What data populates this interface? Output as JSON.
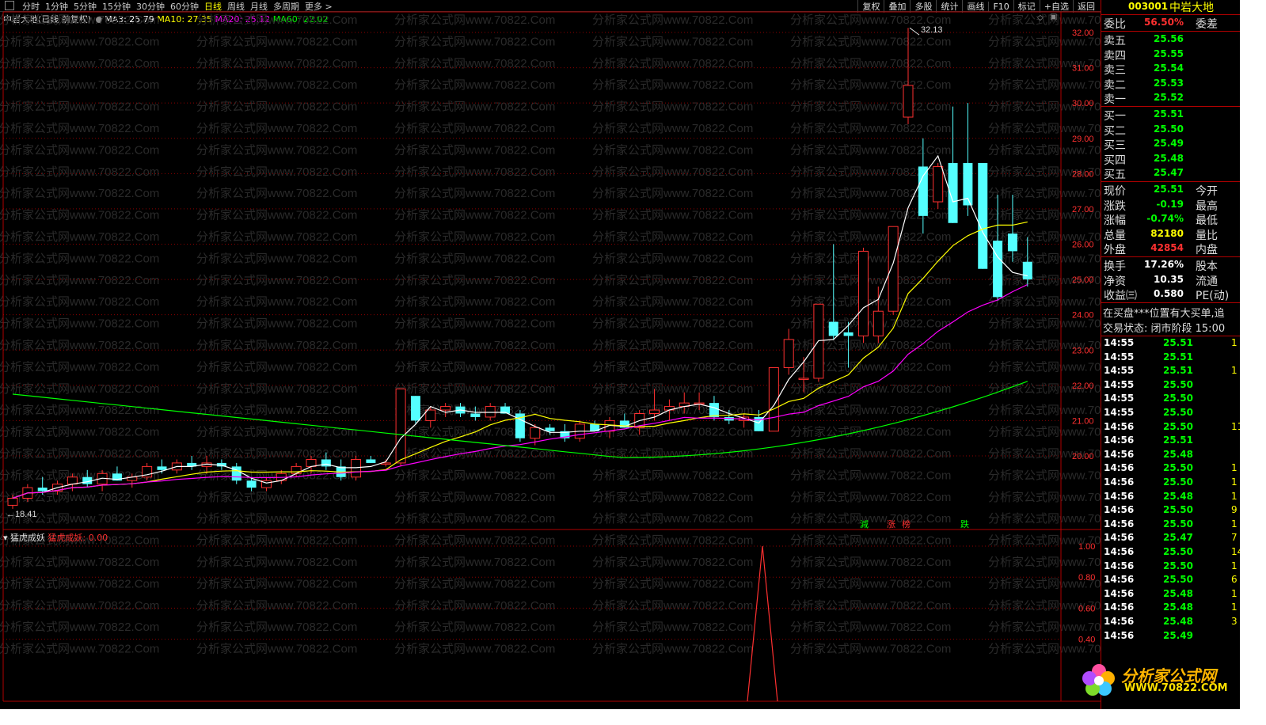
{
  "toolbar": {
    "periods": [
      "分时",
      "1分钟",
      "5分钟",
      "15分钟",
      "30分钟",
      "60分钟",
      "日线",
      "周线",
      "月线",
      "多周期",
      "更多 >"
    ],
    "active_period": "日线",
    "actions": [
      "复权",
      "叠加",
      "多股",
      "统计",
      "画线",
      "F10",
      "标记",
      "+自选",
      "返回"
    ]
  },
  "chart_title": {
    "name": "中岩大地(日线 前复权)",
    "ma3": "MA3: 25.79",
    "ma10": "MA10: 27.35",
    "ma20": "MA20: 25.12",
    "ma60": "MA60: 22.02"
  },
  "indicator_title": {
    "name": "猛虎成妖",
    "value": "猛虎成妖: 0.00"
  },
  "chart_data": {
    "type": "candlestick",
    "price_axis": {
      "ticks": [
        "32.00",
        "31.00",
        "30.00",
        "29.00",
        "28.00",
        "27.00",
        "26.00",
        "25.00",
        "24.00",
        "23.00",
        "22.00",
        "21.00",
        "20.00"
      ]
    },
    "indicator_axis": {
      "ticks": [
        "1.00",
        "0.80",
        "0.60",
        "0.40"
      ]
    },
    "annotations": {
      "high_label": "32.13",
      "low_label": "18.41",
      "signals": [
        "減",
        "涨",
        "榜",
        "跌"
      ]
    },
    "ohlc": [
      [
        18.6,
        18.9,
        18.5,
        18.8
      ],
      [
        18.8,
        19.2,
        18.7,
        19.1
      ],
      [
        19.1,
        19.4,
        18.9,
        19.0
      ],
      [
        19.0,
        19.3,
        18.9,
        19.2
      ],
      [
        19.2,
        19.5,
        19.0,
        19.4
      ],
      [
        19.4,
        19.6,
        19.1,
        19.2
      ],
      [
        19.2,
        19.6,
        19.0,
        19.5
      ],
      [
        19.5,
        19.7,
        19.3,
        19.3
      ],
      [
        19.3,
        19.5,
        19.1,
        19.4
      ],
      [
        19.4,
        19.8,
        19.3,
        19.7
      ],
      [
        19.7,
        19.9,
        19.5,
        19.6
      ],
      [
        19.6,
        19.9,
        19.5,
        19.8
      ],
      [
        19.8,
        20.0,
        19.6,
        19.7
      ],
      [
        19.7,
        20.0,
        19.5,
        19.8
      ],
      [
        19.8,
        19.9,
        19.6,
        19.7
      ],
      [
        19.7,
        19.8,
        19.2,
        19.3
      ],
      [
        19.3,
        19.4,
        19.0,
        19.1
      ],
      [
        19.1,
        19.4,
        19.0,
        19.3
      ],
      [
        19.3,
        19.6,
        19.2,
        19.5
      ],
      [
        19.5,
        19.8,
        19.4,
        19.7
      ],
      [
        19.7,
        20.0,
        19.5,
        19.9
      ],
      [
        19.9,
        20.1,
        19.6,
        19.7
      ],
      [
        19.7,
        19.9,
        19.3,
        19.4
      ],
      [
        19.4,
        20.0,
        19.3,
        19.9
      ],
      [
        19.9,
        20.0,
        19.8,
        19.8
      ],
      [
        19.8,
        19.9,
        19.7,
        19.8
      ],
      [
        19.8,
        21.9,
        19.7,
        21.9
      ],
      [
        21.7,
        21.7,
        20.9,
        21.0
      ],
      [
        21.0,
        21.4,
        20.8,
        21.3
      ],
      [
        21.3,
        21.5,
        21.1,
        21.4
      ],
      [
        21.4,
        21.5,
        21.1,
        21.2
      ],
      [
        21.2,
        21.4,
        21.0,
        21.1
      ],
      [
        21.1,
        21.5,
        21.0,
        21.4
      ],
      [
        21.4,
        21.5,
        21.2,
        21.2
      ],
      [
        21.2,
        21.3,
        20.4,
        20.5
      ],
      [
        20.5,
        20.9,
        20.3,
        20.8
      ],
      [
        20.8,
        20.9,
        20.6,
        20.7
      ],
      [
        20.7,
        20.9,
        20.4,
        20.5
      ],
      [
        20.5,
        21.0,
        20.4,
        20.9
      ],
      [
        20.9,
        21.0,
        20.7,
        20.7
      ],
      [
        20.7,
        21.1,
        20.5,
        21.0
      ],
      [
        21.0,
        21.2,
        20.8,
        20.8
      ],
      [
        20.8,
        21.3,
        20.6,
        21.2
      ],
      [
        21.2,
        21.9,
        21.0,
        21.3
      ],
      [
        21.3,
        21.6,
        21.0,
        21.4
      ],
      [
        21.4,
        21.8,
        21.2,
        21.5
      ],
      [
        21.5,
        21.8,
        21.3,
        21.5
      ],
      [
        21.5,
        21.7,
        21.0,
        21.1
      ],
      [
        21.1,
        21.3,
        20.9,
        21.0
      ],
      [
        21.0,
        21.2,
        20.8,
        21.1
      ],
      [
        21.1,
        21.3,
        20.7,
        20.7
      ],
      [
        20.7,
        22.5,
        20.7,
        22.5
      ],
      [
        22.5,
        23.6,
        22.3,
        23.3
      ],
      [
        22.2,
        22.8,
        21.8,
        22.2
      ],
      [
        22.2,
        24.3,
        22.1,
        24.3
      ],
      [
        23.8,
        26.0,
        23.3,
        23.4
      ],
      [
        23.5,
        23.8,
        22.5,
        23.4
      ],
      [
        23.4,
        25.9,
        23.2,
        25.8
      ],
      [
        23.4,
        24.8,
        23.2,
        24.1
      ],
      [
        24.1,
        26.5,
        24.0,
        26.5
      ],
      [
        29.6,
        32.13,
        29.4,
        30.5
      ],
      [
        28.2,
        29.0,
        26.3,
        26.8
      ],
      [
        27.2,
        28.3,
        27.0,
        28.2
      ],
      [
        28.3,
        29.9,
        26.6,
        26.6
      ],
      [
        28.3,
        30.0,
        26.8,
        27.1
      ],
      [
        28.3,
        28.3,
        25.3,
        25.3
      ],
      [
        26.1,
        27.4,
        24.4,
        24.5
      ],
      [
        26.3,
        27.4,
        25.5,
        25.8
      ],
      [
        25.5,
        26.2,
        24.8,
        25.0
      ]
    ]
  },
  "panel": {
    "code": "003001",
    "name": "中岩大地",
    "weibi": {
      "label": "委比",
      "value": "56.50%",
      "label2": "委差"
    },
    "asks": [
      {
        "label": "卖五",
        "price": "25.56"
      },
      {
        "label": "卖四",
        "price": "25.55"
      },
      {
        "label": "卖三",
        "price": "25.54"
      },
      {
        "label": "卖二",
        "price": "25.53"
      },
      {
        "label": "卖一",
        "price": "25.52"
      }
    ],
    "bids": [
      {
        "label": "买一",
        "price": "25.51"
      },
      {
        "label": "买二",
        "price": "25.50"
      },
      {
        "label": "买三",
        "price": "25.49"
      },
      {
        "label": "买四",
        "price": "25.48"
      },
      {
        "label": "买五",
        "price": "25.47"
      }
    ],
    "stats": [
      {
        "label": "现价",
        "value": "25.51",
        "label2": "今开",
        "cls": "g"
      },
      {
        "label": "涨跌",
        "value": "-0.19",
        "label2": "最高",
        "cls": "g"
      },
      {
        "label": "涨幅",
        "value": "-0.74%",
        "label2": "最低",
        "cls": "g"
      },
      {
        "label": "总量",
        "value": "82180",
        "label2": "量比",
        "cls": "y"
      },
      {
        "label": "外盘",
        "value": "42854",
        "label2": "内盘",
        "cls": "r"
      }
    ],
    "stats2": [
      {
        "label": "换手",
        "value": "17.26%",
        "label2": "股本"
      },
      {
        "label": "净资",
        "value": "10.35",
        "label2": "流通"
      },
      {
        "label": "收益㈢",
        "value": "0.580",
        "label2": "PE(动)"
      }
    ],
    "notice": "在买盘***位置有大买单,追",
    "status": "交易状态: 闭市阶段 15:00",
    "ticks": [
      {
        "time": "14:55",
        "price": "25.51",
        "vol": "1"
      },
      {
        "time": "14:55",
        "price": "25.51",
        "vol": ""
      },
      {
        "time": "14:55",
        "price": "25.51",
        "vol": "1"
      },
      {
        "time": "14:55",
        "price": "25.50",
        "vol": ""
      },
      {
        "time": "14:55",
        "price": "25.50",
        "vol": ""
      },
      {
        "time": "14:55",
        "price": "25.50",
        "vol": ""
      },
      {
        "time": "14:56",
        "price": "25.50",
        "vol": "11"
      },
      {
        "time": "14:56",
        "price": "25.51",
        "vol": ""
      },
      {
        "time": "14:56",
        "price": "25.48",
        "vol": ""
      },
      {
        "time": "14:56",
        "price": "25.50",
        "vol": "1"
      },
      {
        "time": "14:56",
        "price": "25.50",
        "vol": "1"
      },
      {
        "time": "14:56",
        "price": "25.48",
        "vol": "1"
      },
      {
        "time": "14:56",
        "price": "25.50",
        "vol": "9"
      },
      {
        "time": "14:56",
        "price": "25.50",
        "vol": "1"
      },
      {
        "time": "14:56",
        "price": "25.47",
        "vol": "7"
      },
      {
        "time": "14:56",
        "price": "25.50",
        "vol": "14"
      },
      {
        "time": "14:56",
        "price": "25.50",
        "vol": "1"
      },
      {
        "time": "14:56",
        "price": "25.50",
        "vol": "6"
      },
      {
        "time": "14:56",
        "price": "25.48",
        "vol": "1"
      },
      {
        "time": "14:56",
        "price": "25.48",
        "vol": "1"
      },
      {
        "time": "14:56",
        "price": "25.48",
        "vol": "3"
      },
      {
        "time": "14:56",
        "price": "25.49",
        "vol": ""
      }
    ]
  },
  "watermark": "分析家公式网www.70822.Com",
  "logo": {
    "title": "分析家公式网",
    "url": "WWW.70822.COM"
  },
  "colors": {
    "up": "#ff3030",
    "down": "#54ffff",
    "ma3": "#ffffff",
    "ma10": "#ffff00",
    "ma20": "#ff00ff",
    "ma60": "#00ff00",
    "grid": "#8b0000"
  }
}
